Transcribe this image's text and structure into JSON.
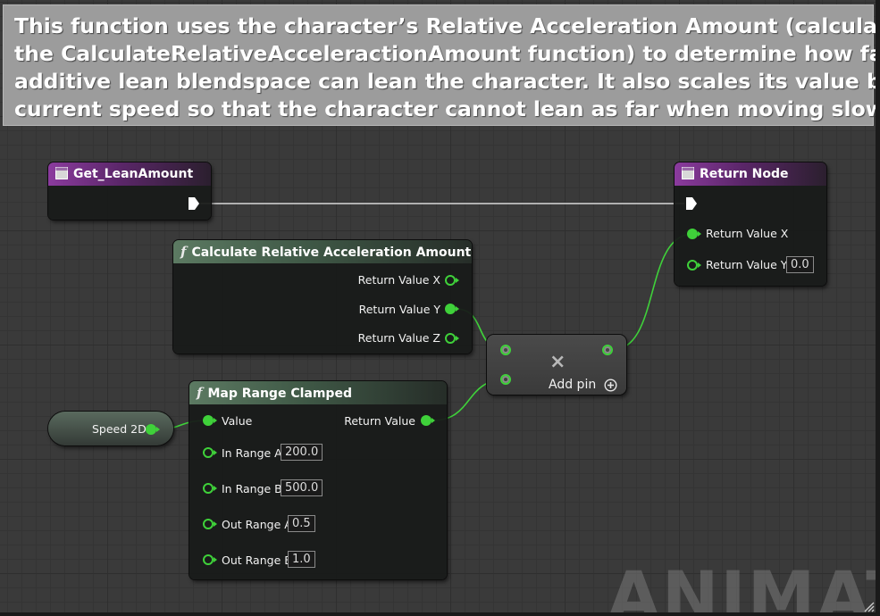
{
  "comment": {
    "lines": [
      "This function uses the character’s Relative Acceleration Amount (calculated from",
      "the CalculateRelativeAcceleractionAmount function) to determine how far the",
      "additive lean blendspace can lean the character. It also scales its value by the",
      "current speed so that the character cannot lean as far when moving slowly."
    ]
  },
  "nodes": {
    "entry": {
      "title": "Get_LeanAmount",
      "icon": "function-entry-icon"
    },
    "return_node": {
      "title": "Return Node",
      "icon": "function-entry-icon",
      "pins": {
        "x_label": "Return Value X",
        "y_label": "Return Value Y",
        "y_value": "0.0"
      }
    },
    "calc_accel": {
      "title": "Calculate Relative Acceleration Amount",
      "icon": "function-icon",
      "pins": {
        "x_label": "Return Value X",
        "y_label": "Return Value Y",
        "z_label": "Return Value Z"
      }
    },
    "map_range": {
      "title": "Map Range Clamped",
      "icon": "function-icon",
      "pins": {
        "value_label": "Value",
        "return_label": "Return Value",
        "in_a_label": "In Range A",
        "in_a_value": "200.0",
        "in_b_label": "In Range B",
        "in_b_value": "500.0",
        "out_a_label": "Out Range A",
        "out_a_value": "0.5",
        "out_b_label": "Out Range B",
        "out_b_value": "1.0"
      }
    },
    "speed": {
      "label": "Speed 2D"
    },
    "multiply": {
      "symbol": "×",
      "add_pin_label": "Add pin",
      "add_pin_icon": "plus-circle-icon"
    }
  },
  "watermark": "ANIMATIC",
  "colors": {
    "float_pin": "#3fd13a",
    "exec_pin": "#ffffff",
    "function_header": "#5c7a62",
    "entry_header": "#8b3b9e"
  }
}
